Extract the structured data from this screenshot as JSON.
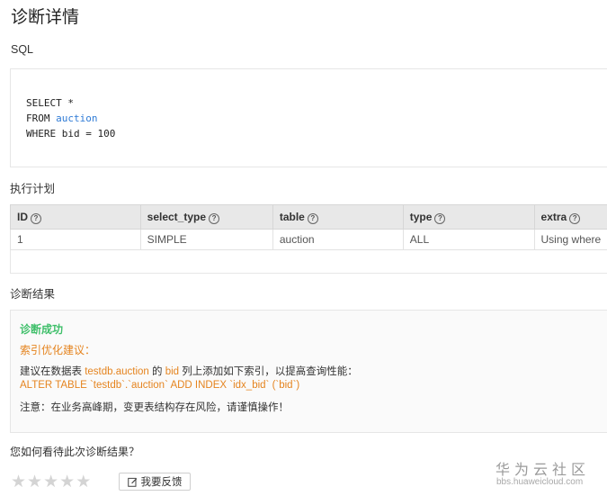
{
  "page": {
    "title": "诊断详情"
  },
  "sql_section": {
    "label": "SQL",
    "line1": "SELECT *",
    "line2_keyword": "FROM ",
    "line2_table": "auction",
    "line3": "WHERE bid = 100"
  },
  "plan": {
    "label": "执行计划",
    "columns": [
      "ID",
      "select_type",
      "table",
      "type",
      "extra"
    ],
    "rows": [
      [
        "1",
        "SIMPLE",
        "auction",
        "ALL",
        "Using where"
      ]
    ]
  },
  "result": {
    "label": "诊断结果",
    "status": "诊断成功",
    "advice_title": "索引优化建议：",
    "advice_prefix": "建议在数据表 ",
    "advice_table": "testdb.auction",
    "advice_mid": " 的 ",
    "advice_column": "bid",
    "advice_suffix": " 列上添加如下索引，以提高查询性能：",
    "index_sql": "ALTER TABLE `testdb`.`auction` ADD INDEX `idx_bid` (`bid`)",
    "warning": "注意：在业务高峰期，变更表结构存在风险，请谨慎操作！"
  },
  "feedback": {
    "question": "您如何看待此次诊断结果？",
    "rating": 0,
    "max_rating": 5,
    "button_label": "我要反馈"
  },
  "watermark": {
    "main": "华为云社区",
    "sub": "bbs.huaweicloud.com"
  },
  "colors": {
    "success": "#3fbf6a",
    "accent_orange": "#e5841f",
    "table_link": "#2f7bd6"
  }
}
